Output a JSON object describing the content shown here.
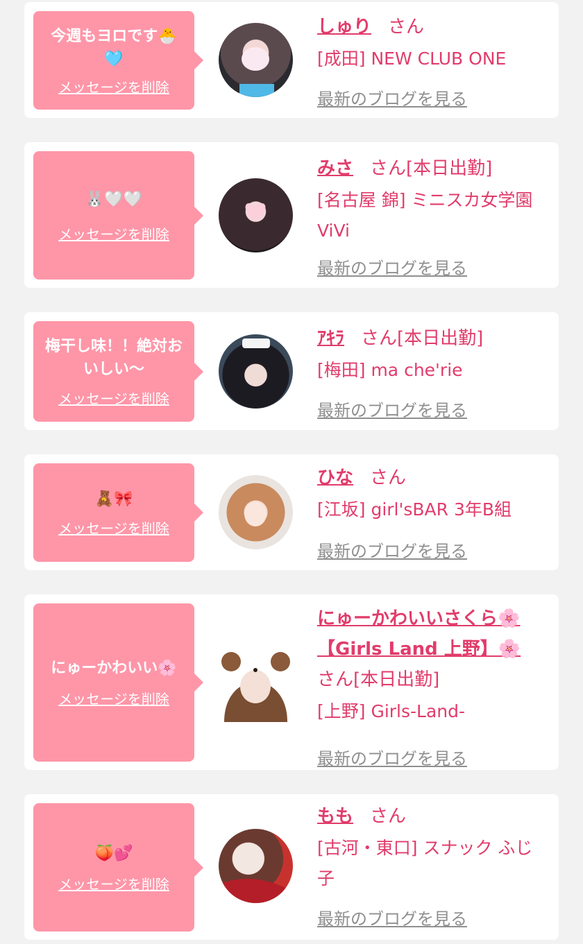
{
  "colors": {
    "background": "#f2f2f2",
    "card": "#ffffff",
    "bubble": "#fe96a8",
    "accent": "#e13c6b",
    "muted": "#8f8f8f"
  },
  "delete_label": "メッセージを削除",
  "blog_label": "最新のブログを見る",
  "san": "さん",
  "on_duty": "[本日出勤]",
  "entries": [
    {
      "message": "今週もヨロです🐣 🩵",
      "name": "しゅり",
      "shop": "[成田] NEW CLUB ONE",
      "on_duty": false
    },
    {
      "message": "🐰🤍🤍",
      "name": "みさ",
      "shop": "[名古屋 錦] ミニスカ女学園ViVi",
      "on_duty": true
    },
    {
      "message": "梅干し味！！絶対おいしい〜",
      "name": "ｱｷﾗ",
      "shop": "[梅田] ma che'rie",
      "on_duty": true
    },
    {
      "message": "🧸🎀",
      "name": "ひな",
      "shop": "[江坂] girl'sBAR 3年B組",
      "on_duty": false
    },
    {
      "message": "にゅーかわいい🌸",
      "name": "にゅーかわいいさくら🌸【Girls Land 上野】🌸",
      "shop": "[上野] Girls-Land-",
      "on_duty": true
    },
    {
      "message": "🍑💕",
      "name": "もも",
      "shop": "[古河・東口] スナック ふじ子",
      "on_duty": false
    }
  ]
}
